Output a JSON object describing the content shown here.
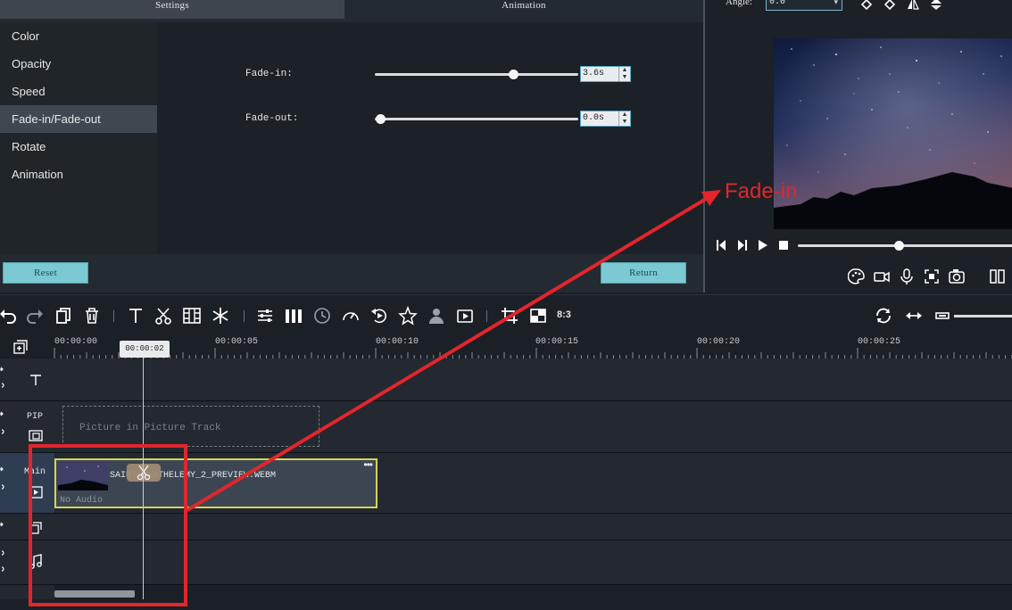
{
  "tabs": {
    "settings": "Settings",
    "animation": "Animation"
  },
  "side_menu": {
    "items": [
      {
        "label": "Color"
      },
      {
        "label": "Opacity"
      },
      {
        "label": "Speed"
      },
      {
        "label": "Fade-in/Fade-out",
        "active": true
      },
      {
        "label": "Rotate"
      },
      {
        "label": "Animation"
      }
    ]
  },
  "fade_in": {
    "label": "Fade-in:",
    "value": "3.6s",
    "level_fraction": 0.69
  },
  "fade_out": {
    "label": "Fade-out:",
    "value": "0.0s",
    "level_fraction": 0.0
  },
  "buttons": {
    "reset": "Reset",
    "return": "Return"
  },
  "preview": {
    "angle_label": "Angle:",
    "angle_value": "0.0",
    "progress_fraction": 0.47
  },
  "toolbar": {
    "ratio": "8:3"
  },
  "ruler": {
    "labels": [
      "00:00:00",
      "00:00:05",
      "00:00:10",
      "00:00:15",
      "00:00:20",
      "00:00:25"
    ]
  },
  "playhead": {
    "time": "00:00:02"
  },
  "tracks": {
    "pip_label": "PIP",
    "pip_placeholder": "Picture in Picture Track",
    "main_label": "Main"
  },
  "clip": {
    "name": "SAINT-BARTHELEMY_2_PREVIEW.WEBM",
    "audio": "No Audio"
  },
  "annotation": {
    "text": "Fade-in",
    "color": "#e2262b"
  },
  "colors": {
    "accent_teal": "#7bc9d2",
    "clip_border": "#d6d454"
  }
}
